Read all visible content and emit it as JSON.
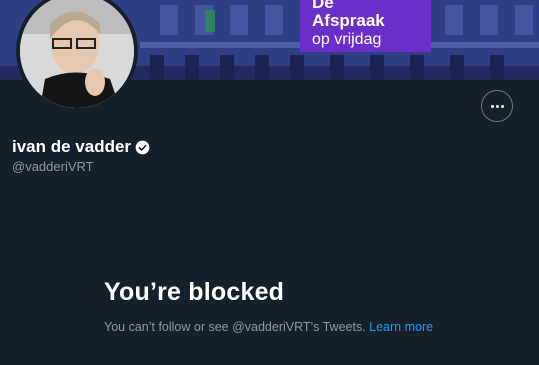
{
  "banner": {
    "promo_line1": "De",
    "promo_line2": "Afspraak",
    "promo_line3": "op vrijdag"
  },
  "profile": {
    "name": "ivan de vadder",
    "handle": "@vadderiVRT",
    "verified": true
  },
  "more_button": {
    "icon": "more-horizontal-icon"
  },
  "blocked": {
    "title": "You’re blocked",
    "message": "You can’t follow or see @vadderiVRT’s Tweets.",
    "link_label": "Learn more"
  },
  "colors": {
    "background": "#15202b",
    "accent": "#1d9bf0",
    "secondary_text": "#8b98a5",
    "promo": "#6b2fc9"
  }
}
